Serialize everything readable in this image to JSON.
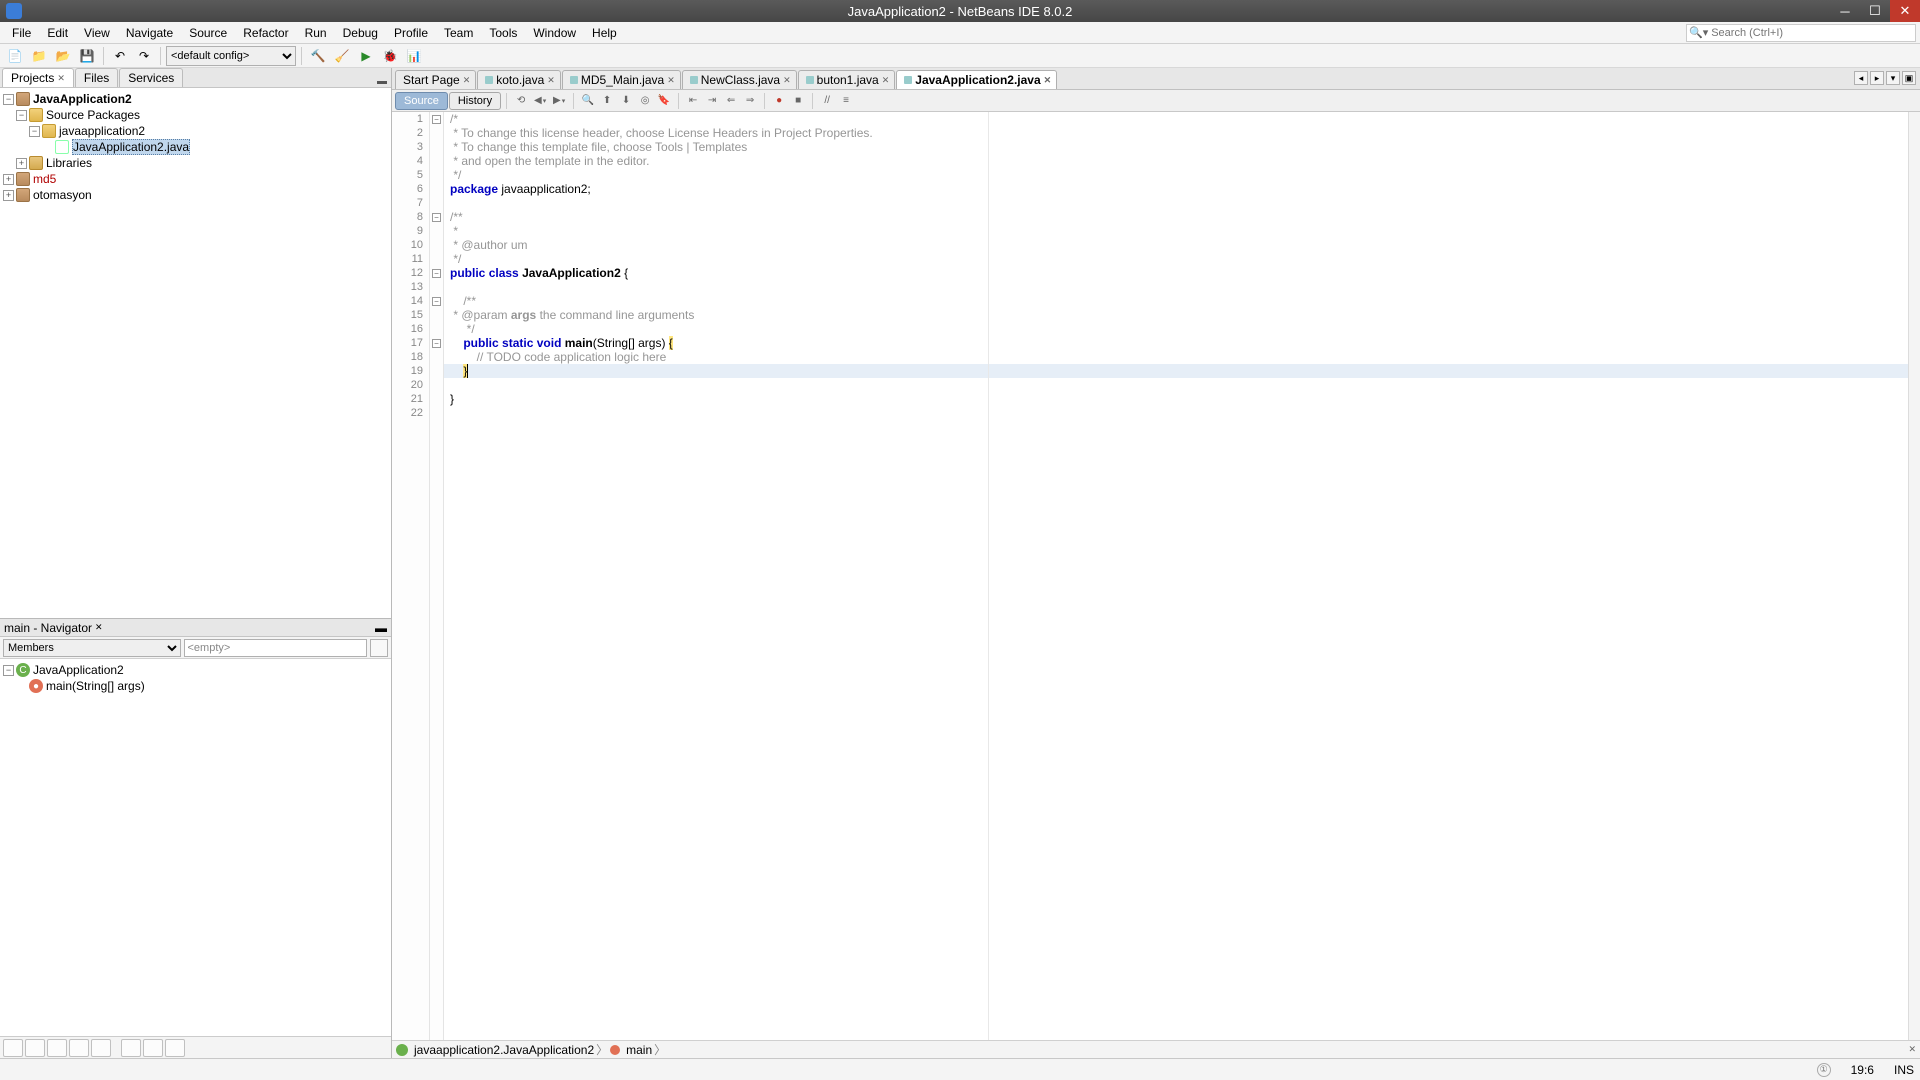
{
  "window": {
    "title": "JavaApplication2 - NetBeans IDE 8.0.2"
  },
  "menu": [
    "File",
    "Edit",
    "View",
    "Navigate",
    "Source",
    "Refactor",
    "Run",
    "Debug",
    "Profile",
    "Team",
    "Tools",
    "Window",
    "Help"
  ],
  "search_placeholder": "Search (Ctrl+I)",
  "toolbar_config": "<default config>",
  "left_tabs": {
    "projects": "Projects",
    "files": "Files",
    "services": "Services"
  },
  "tree": {
    "app": "JavaApplication2",
    "srcpkg": "Source Packages",
    "pkg": "javaapplication2",
    "cls": "JavaApplication2.java",
    "libs": "Libraries",
    "md5": "md5",
    "oto": "otomasyon"
  },
  "navigator": {
    "title": "main - Navigator",
    "filter_mode": "Members",
    "filter_text": "<empty>",
    "root": "JavaApplication2",
    "main": "main(String[] args)"
  },
  "editor_tabs": [
    {
      "label": "Start Page",
      "closable": true,
      "icon": "page"
    },
    {
      "label": "koto.java",
      "closable": true,
      "icon": "java"
    },
    {
      "label": "MD5_Main.java",
      "closable": true,
      "icon": "java"
    },
    {
      "label": "NewClass.java",
      "closable": true,
      "icon": "java"
    },
    {
      "label": "buton1.java",
      "closable": true,
      "icon": "java"
    },
    {
      "label": "JavaApplication2.java",
      "closable": true,
      "icon": "java",
      "active": true
    }
  ],
  "src_tabs": {
    "source": "Source",
    "history": "History"
  },
  "code_comment1": " * To change this license header, choose License Headers in Project Properties.",
  "code_comment2": " * To change this template file, choose Tools | Templates",
  "code_comment3": " * and open the template in the editor.",
  "code_pkg_kw": "package",
  "code_pkg_name": " javaapplication2;",
  "code_author": " * @author um",
  "code_param_pre": " * @param ",
  "code_param_name": "args",
  "code_param_post": " the command line arguments",
  "code_class_pre": "public class ",
  "code_class_name": "JavaApplication2",
  "code_class_post": " {",
  "code_main_public": "public",
  "code_main_static": "static",
  "code_main_void": "void",
  "code_main_name": "main",
  "code_main_sig": "(String[] args) ",
  "code_todo": "        // TODO code application logic here",
  "breadcrumb": {
    "cls": "javaapplication2.JavaApplication2",
    "m": "main"
  },
  "status": {
    "pos": "19:6",
    "ins": "INS",
    "info": "①"
  }
}
